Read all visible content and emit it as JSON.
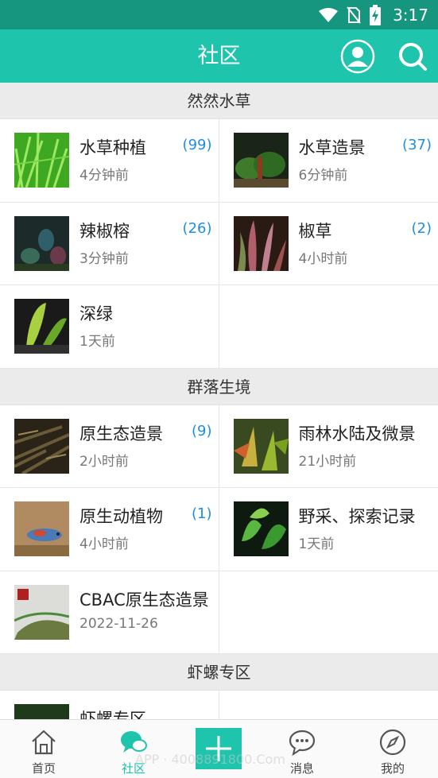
{
  "status": {
    "time": "3:17"
  },
  "header": {
    "title": "社区",
    "profile_icon": "profile-icon",
    "search_icon": "search-icon"
  },
  "sections": [
    {
      "title": "然然水草",
      "items": [
        {
          "name": "水草种植",
          "time": "4分钟前",
          "count": "(99)"
        },
        {
          "name": "水草造景",
          "time": "6分钟前",
          "count": "(37)"
        },
        {
          "name": "辣椒榕",
          "time": "3分钟前",
          "count": "(26)"
        },
        {
          "name": "椒草",
          "time": "4小时前",
          "count": "(2)"
        },
        {
          "name": "深绿",
          "time": "1天前",
          "count": ""
        }
      ]
    },
    {
      "title": "群落生境",
      "items": [
        {
          "name": "原生态造景",
          "time": "2小时前",
          "count": "(9)"
        },
        {
          "name": "雨林水陆及微景",
          "time": "21小时前",
          "count": ""
        },
        {
          "name": "原生动植物",
          "time": "4小时前",
          "count": "(1)"
        },
        {
          "name": "野采、探索记录",
          "time": "1天前",
          "count": ""
        },
        {
          "name": "CBAC原生态造景",
          "time": "2022-11-26",
          "count": ""
        }
      ]
    },
    {
      "title": "虾螺专区",
      "items": [
        {
          "name": "虾螺专区",
          "time": "",
          "count": ""
        }
      ]
    }
  ],
  "tabbar": {
    "tabs": [
      {
        "label": "首页",
        "icon": "home-icon"
      },
      {
        "label": "社区",
        "icon": "community-icon"
      },
      {
        "label": "消息",
        "icon": "message-icon"
      },
      {
        "label": "我的",
        "icon": "compass-icon"
      }
    ],
    "add_icon": "plus-icon",
    "watermark": "APP · 4008891800.Com"
  },
  "colors": {
    "accent": "#1ec4ab",
    "status_bar": "#17967f",
    "count": "#1e8ee0"
  }
}
